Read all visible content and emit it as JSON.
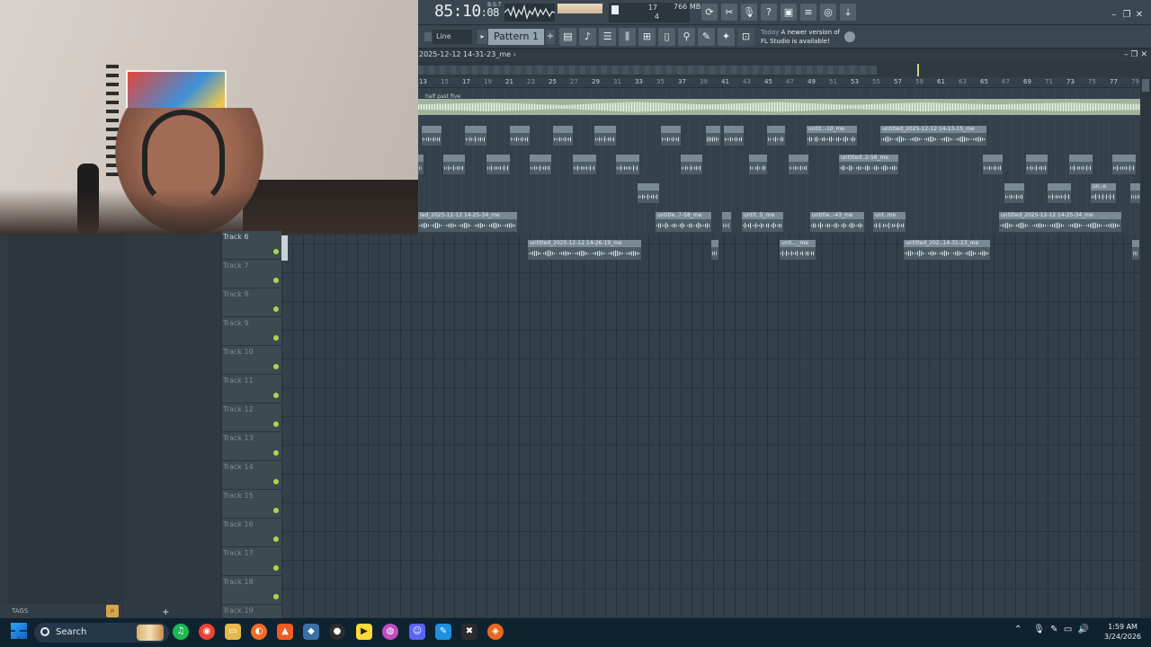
{
  "toolbar": {
    "time_main": "85:10",
    "time_sub": ":08",
    "bst_label": "B:S:T",
    "cpu_value": "17",
    "poly_value": "4",
    "memory": "766 MB",
    "news_today": "Today",
    "news_line1": "A newer version of",
    "news_line2": "FL Studio is available!"
  },
  "transport": {
    "line_select": "Line",
    "pattern_label": "Pattern 1"
  },
  "playlist": {
    "title": "2025-12-12 14-31-23_me",
    "arrow": "›",
    "master_clip": "half past five",
    "ruler": [
      "13",
      "15",
      "17",
      "19",
      "21",
      "23",
      "25",
      "27",
      "29",
      "31",
      "33",
      "35",
      "37",
      "39",
      "41",
      "43",
      "45",
      "47",
      "49",
      "51",
      "53",
      "55",
      "57",
      "59",
      "61",
      "63",
      "65",
      "67",
      "69",
      "71",
      "73",
      "75",
      "77",
      "79"
    ],
    "clips": [
      {
        "label": "untit..-10_me"
      },
      {
        "label": "untitled_2025-12-12 14-13-15_me"
      },
      {
        "label": "untitled..2-56_me"
      },
      {
        "label": "un..e"
      },
      {
        "label": "led_2025-12-12 14-25-34_me"
      },
      {
        "label": "untitle..7-58_me"
      },
      {
        "label": "untit..5_me"
      },
      {
        "label": "untitle..-43_me"
      },
      {
        "label": "unt..me"
      },
      {
        "label": "untitled_2025-12-12 14-25-34_me"
      },
      {
        "label": "untitled_2025-12-12 14-26-19_me"
      },
      {
        "label": "unti..._me"
      },
      {
        "label": "untitled_202..14-31-23_me"
      }
    ],
    "tracks": [
      "Track 6",
      "Track 7",
      "Track 8",
      "Track 9",
      "Track 10",
      "Track 11",
      "Track 12",
      "Track 13",
      "Track 14",
      "Track 15",
      "Track 16",
      "Track 17",
      "Track 18",
      "Track 19"
    ]
  },
  "browser": {
    "tags_label": "TAGS",
    "add_label": "+"
  },
  "taskbar": {
    "search_label": "Search",
    "time": "1:59 AM",
    "date": "3/24/2026"
  }
}
